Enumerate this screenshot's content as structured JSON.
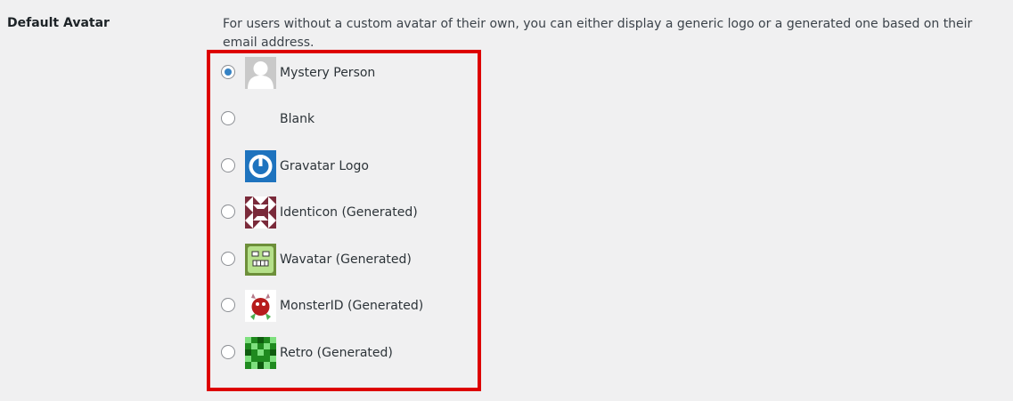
{
  "setting": {
    "label": "Default Avatar",
    "description": "For users without a custom avatar of their own, you can either display a generic logo or a generated one based on their email address."
  },
  "options": [
    {
      "label": "Mystery Person",
      "icon": "mystery-person-avatar",
      "selected": true
    },
    {
      "label": "Blank",
      "icon": "blank-avatar",
      "selected": false
    },
    {
      "label": "Gravatar Logo",
      "icon": "gravatar-logo-avatar",
      "selected": false
    },
    {
      "label": "Identicon (Generated)",
      "icon": "identicon-avatar",
      "selected": false
    },
    {
      "label": "Wavatar (Generated)",
      "icon": "wavatar-avatar",
      "selected": false
    },
    {
      "label": "MonsterID (Generated)",
      "icon": "monsterid-avatar",
      "selected": false
    },
    {
      "label": "Retro (Generated)",
      "icon": "retro-avatar",
      "selected": false
    }
  ],
  "colors": {
    "highlight_border": "#dd0000",
    "radio_checked": "#3582c4",
    "gravatar_blue": "#1e73be",
    "identicon": "#7a2a3a",
    "wavatar": "#9ccc65",
    "monster": "#b71c1c",
    "retro": "#2e9e2e"
  }
}
